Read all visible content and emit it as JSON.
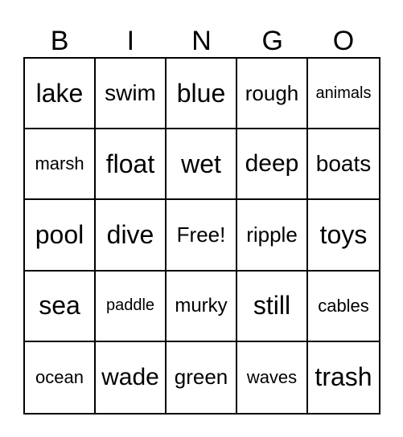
{
  "header": [
    "B",
    "I",
    "N",
    "G",
    "O"
  ],
  "cells": [
    [
      "lake",
      "swim",
      "blue",
      "rough",
      "animals"
    ],
    [
      "marsh",
      "float",
      "wet",
      "deep",
      "boats"
    ],
    [
      "pool",
      "dive",
      "Free!",
      "ripple",
      "toys"
    ],
    [
      "sea",
      "paddle",
      "murky",
      "still",
      "cables"
    ],
    [
      "ocean",
      "wade",
      "green",
      "waves",
      "trash"
    ]
  ]
}
